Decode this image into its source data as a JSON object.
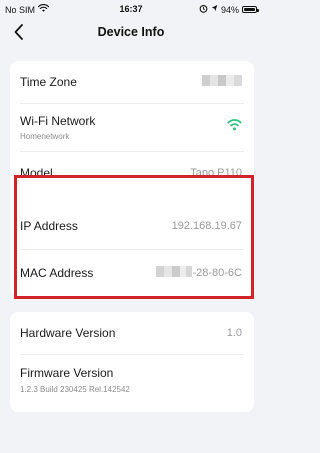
{
  "status_bar": {
    "carrier": "No SIM",
    "time": "16:37",
    "battery": "94%",
    "wifi_icon": "wifi-icon",
    "alarm_icon": "alarm-icon",
    "battery_icon": "battery-icon"
  },
  "nav": {
    "title": "Device Info",
    "back_icon": "chevron-left-icon"
  },
  "sections": {
    "general": {
      "time_zone_label": "Time Zone",
      "wifi_label": "Wi-Fi Network",
      "wifi_name": "Homenetwork",
      "wifi_icon": "wifi-signal-icon",
      "model_label": "Model",
      "model_value": "Tapo P110"
    },
    "network": {
      "ip_label": "IP Address",
      "ip_value": "192.168.19.67",
      "mac_label": "MAC Address",
      "mac_value_visible": "-28-80-6C"
    },
    "versions": {
      "hardware_label": "Hardware Version",
      "hardware_value": "1.0",
      "firmware_label": "Firmware Version",
      "firmware_value": "1.2.3 Build 230425 Rel.142542"
    }
  },
  "colors": {
    "accent_green": "#2ec27e",
    "highlight_red": "#d2232a",
    "background": "#f2f3f7"
  }
}
